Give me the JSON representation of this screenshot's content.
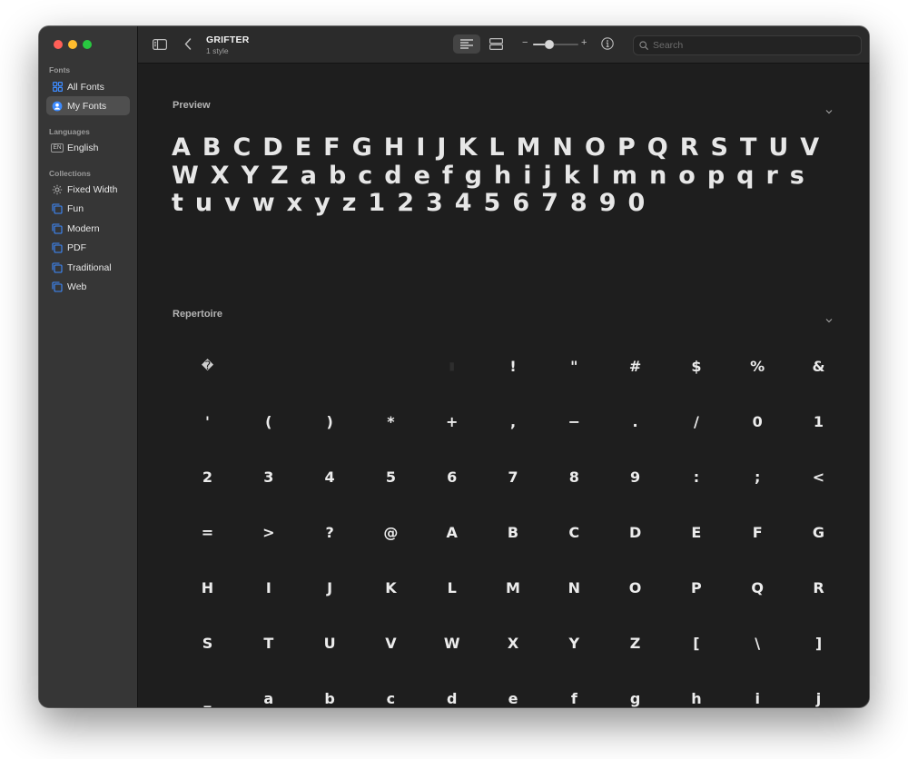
{
  "window": {
    "title": "GRIFTER",
    "subtitle": "1 style"
  },
  "sidebar": {
    "fonts_label": "Fonts",
    "fonts_items": [
      {
        "label": "All Fonts",
        "icon": "grid-icon"
      },
      {
        "label": "My Fonts",
        "icon": "person-icon",
        "active": true
      }
    ],
    "languages_label": "Languages",
    "language_items": [
      {
        "label": "English",
        "badge": "EN",
        "icon": "language-badge-icon"
      }
    ],
    "collections_label": "Collections",
    "collection_items": [
      {
        "label": "Fixed Width",
        "icon": "gear-icon"
      },
      {
        "label": "Fun",
        "icon": "collection-icon"
      },
      {
        "label": "Modern",
        "icon": "collection-icon"
      },
      {
        "label": "PDF",
        "icon": "collection-icon"
      },
      {
        "label": "Traditional",
        "icon": "collection-icon"
      },
      {
        "label": "Web",
        "icon": "collection-icon"
      }
    ]
  },
  "toolbar": {
    "search_placeholder": "Search",
    "size_minus": "−",
    "size_plus": "+",
    "size_slider_fraction": 0.35,
    "view_selected": "sample"
  },
  "preview": {
    "title": "Preview",
    "text": "ABCDEFGHIJKLMNOPQRSTUVWXYZabcdefghijklmnopqrstuvwxyz1234567890"
  },
  "repertoire": {
    "title": "Repertoire",
    "glyphs": [
      "�",
      " ",
      " ",
      " ",
      "▮",
      "!",
      "\"",
      "#",
      "$",
      "%",
      "&",
      "'",
      "(",
      ")",
      "*",
      "+",
      ",",
      "−",
      ".",
      "/",
      "0",
      "1",
      "2",
      "3",
      "4",
      "5",
      "6",
      "7",
      "8",
      "9",
      ":",
      ";",
      "<",
      "=",
      ">",
      "?",
      "@",
      "A",
      "B",
      "C",
      "D",
      "E",
      "F",
      "G",
      "H",
      "I",
      "J",
      "K",
      "L",
      "M",
      "N",
      "O",
      "P",
      "Q",
      "R",
      "S",
      "T",
      "U",
      "V",
      "W",
      "X",
      "Y",
      "Z",
      "[",
      "\\",
      "]",
      "_",
      "a",
      "b",
      "c",
      "d",
      "e",
      "f",
      "g",
      "h",
      "i",
      "j"
    ]
  },
  "colors": {
    "traffic_red": "#ff5f57",
    "traffic_yellow": "#febc2e",
    "traffic_green": "#28c840",
    "accent_blue": "#3d8bff"
  }
}
